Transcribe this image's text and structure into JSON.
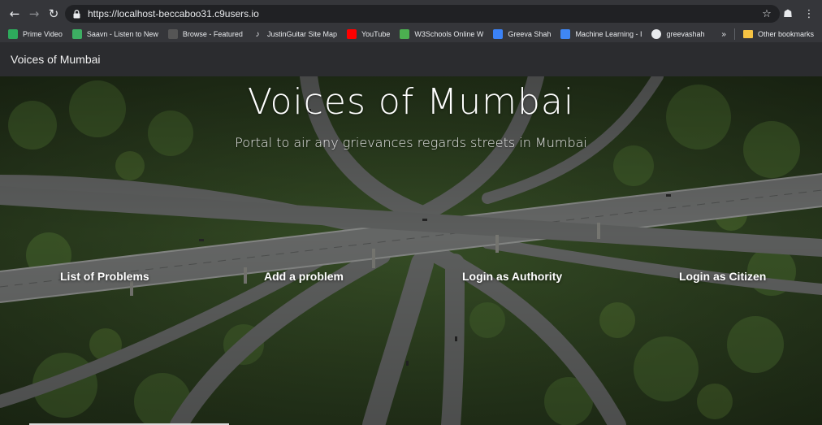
{
  "browser": {
    "url": "https://localhost-beccaboo31.c9users.io",
    "bookmarks": [
      {
        "label": "Prime Video",
        "icon": "prime-video-icon",
        "color": "#2eaa5c"
      },
      {
        "label": "Saavn - Listen to New",
        "icon": "saavn-icon",
        "color": "#3dae63"
      },
      {
        "label": "Browse - Featured",
        "icon": "browse-icon",
        "color": "#555555"
      },
      {
        "label": "JustinGuitar Site Map",
        "icon": "justinguitar-icon",
        "color": "#e8eaed"
      },
      {
        "label": "YouTube",
        "icon": "youtube-icon",
        "color": "#ff0000"
      },
      {
        "label": "W3Schools Online W",
        "icon": "w3schools-icon",
        "color": "#4caf50"
      },
      {
        "label": "Greeva Shah",
        "icon": "greeva-icon",
        "color": "#3b82f6"
      },
      {
        "label": "Machine Learning - I",
        "icon": "coursera-icon",
        "color": "#3f87f5"
      },
      {
        "label": "greevashah",
        "icon": "github-icon",
        "color": "#e8eaed"
      }
    ],
    "other_bookmarks": "Other bookmarks",
    "overflow": "»"
  },
  "navbar": {
    "brand": "Voices of Mumbai"
  },
  "hero": {
    "title": "Voices of Mumbai",
    "subtitle": "Portal to air any grievances regards streets in Mumbai",
    "links": [
      "List of Problems",
      "Add a problem",
      "Login as Authority",
      "Login as Citizen"
    ]
  }
}
